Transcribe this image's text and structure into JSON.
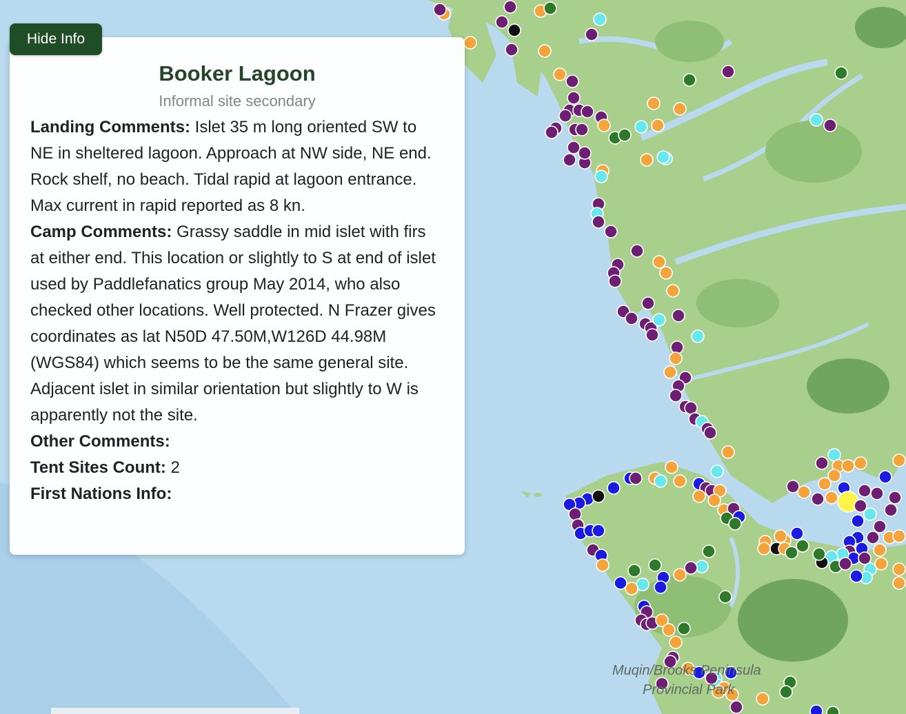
{
  "toggle_button": "Hide Info",
  "info": {
    "title": "Booker Lagoon",
    "subtitle": "Informal site secondary",
    "landing_label": "Landing Comments:",
    "landing_text": "Islet 35 m long oriented SW to NE in sheltered lagoon. Approach at NW side, NE end. Rock shelf, no beach. Tidal rapid at lagoon entrance. Max current in rapid reported as 8 kn.",
    "camp_label": "Camp Comments:",
    "camp_text": "Grassy saddle in mid islet with firs at either end. This location or slightly to S at end of islet used by Paddlefanatics group May 2014, who also checked other locations. Well protected. N Frazer gives coordinates as lat N50D 47.50M,W126D 44.98M (WGS84) which seems to be the same general site. Adjacent islet in similar orientation but slightly to W is apparently not the site.",
    "other_label": "Other Comments:",
    "other_text": "",
    "tent_label": "Tent Sites Count:",
    "tent_value": "2",
    "first_nations_label": "First Nations Info:",
    "first_nations_text": ""
  },
  "map": {
    "place_label_line1": "Muqin/Brooks Peninsula",
    "place_label_line2": "Provincial Park",
    "colors": {
      "water": "#b8d9ee",
      "land": "#a9cf8c",
      "land_dark": "#8fbf74",
      "forest_dark": "#6fa55e",
      "purple": "#6d1f73",
      "orange": "#f4a43a",
      "green": "#2e7a2a",
      "cyan": "#66e8ee",
      "blue": "#1a1ae0",
      "black": "#111111",
      "selected": "#fff34a"
    },
    "legend_note": ""
  }
}
